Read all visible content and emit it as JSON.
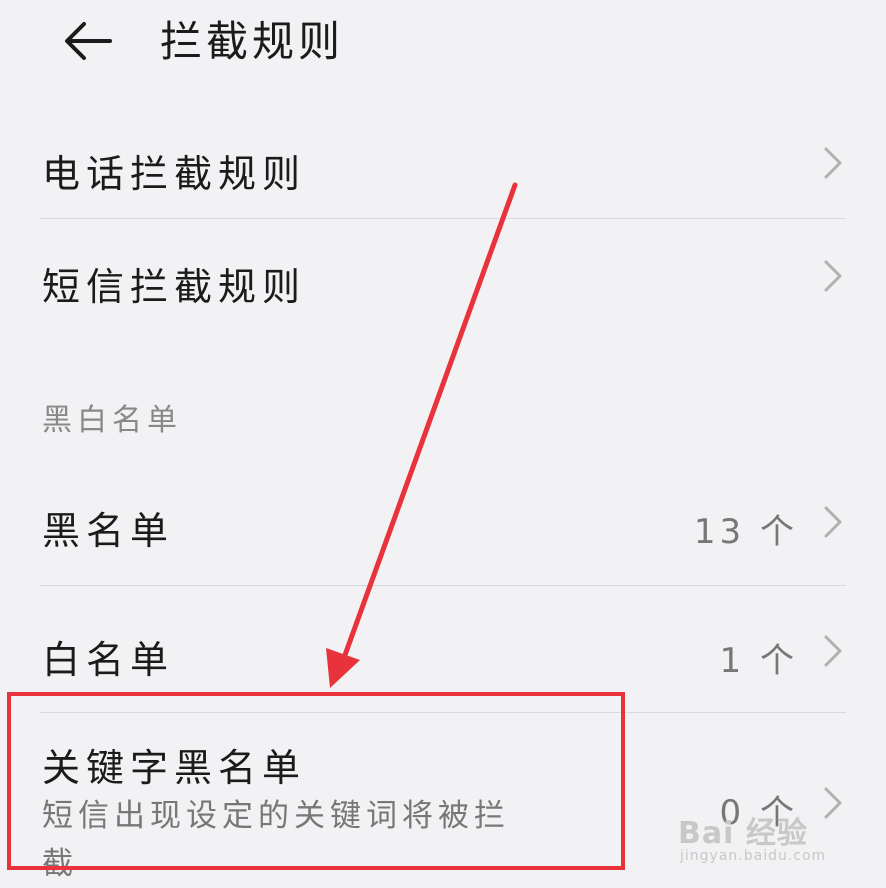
{
  "header": {
    "title": "拦截规则"
  },
  "rules": {
    "call_rules_label": "电话拦截规则",
    "sms_rules_label": "短信拦截规则"
  },
  "lists": {
    "section_title": "黑白名单",
    "blacklist": {
      "label": "黑名单",
      "count": "13 个"
    },
    "whitelist": {
      "label": "白名单",
      "count": "1 个"
    },
    "keyword_blacklist": {
      "label": "关键字黑名单",
      "description": "短信出现设定的关键词将被拦截",
      "count": "0 个"
    }
  },
  "annotation": {
    "highlight_color": "#e8323c"
  },
  "watermark": {
    "main": "Bai 经验",
    "sub": "jingyan.baidu.com"
  },
  "colors": {
    "background": "#f2f2f4",
    "text": "#1b1b1b",
    "secondary": "#777777",
    "accent": "#e8323c"
  }
}
